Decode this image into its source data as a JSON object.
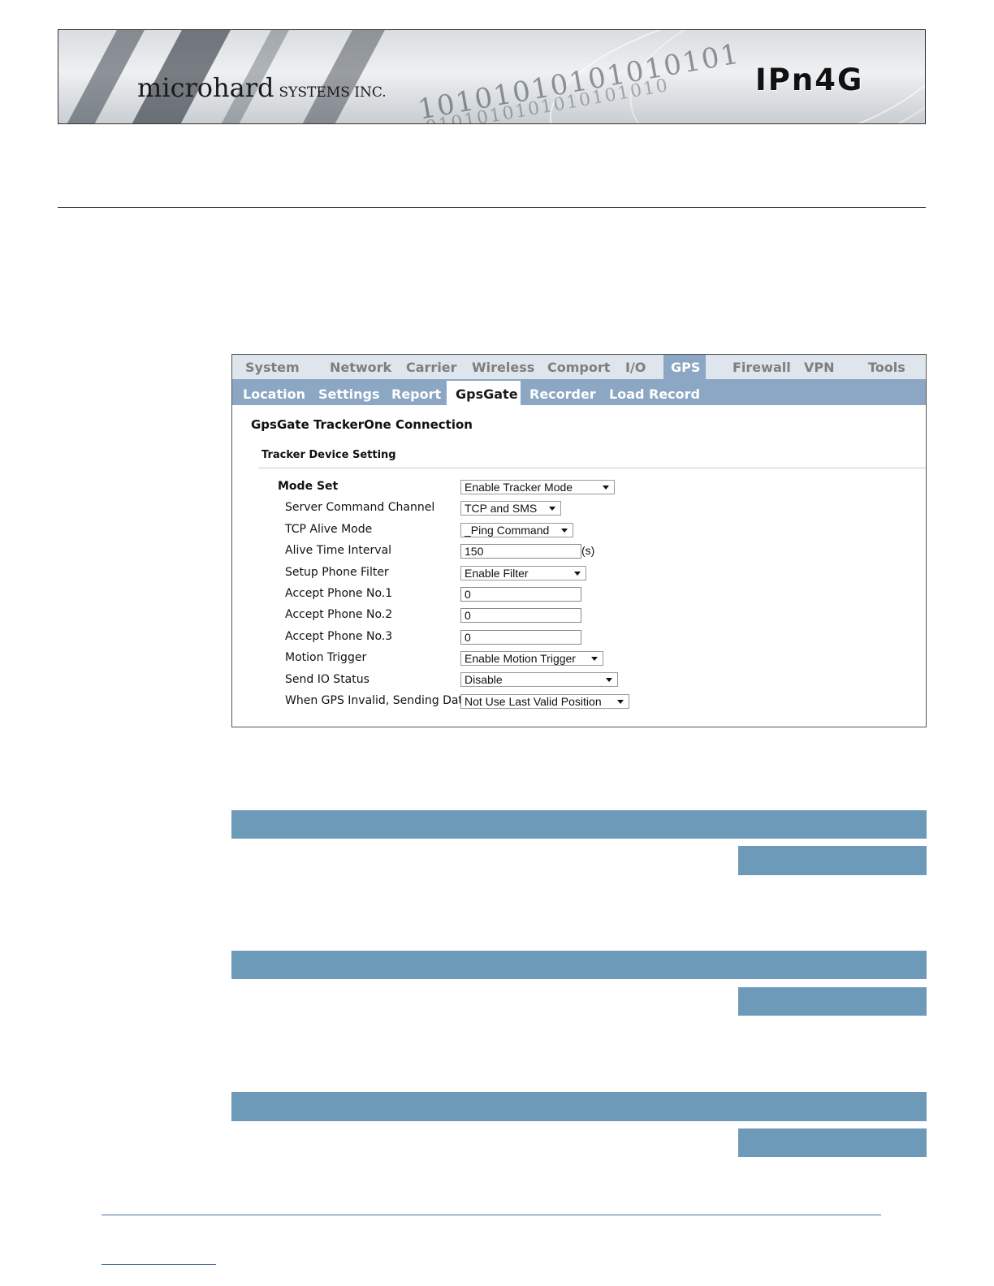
{
  "banner": {
    "brand": "microhard",
    "brand_suffix": "SYSTEMS INC.",
    "product": "IPn4G",
    "binary_1": "10101010101010101",
    "binary_2": "0101010101010101010"
  },
  "nav": {
    "main_tabs": [
      "System",
      "Network",
      "Carrier",
      "Wireless",
      "Comport",
      "I/O",
      "GPS",
      "Firewall",
      "VPN",
      "Tools"
    ],
    "main_active": "GPS",
    "sub_tabs": [
      "Location",
      "Settings",
      "Report",
      "GpsGate",
      "Recorder",
      "Load Record"
    ],
    "sub_active": "GpsGate"
  },
  "page": {
    "title": "GpsGate TrackerOne Connection",
    "section": "Tracker Device Setting"
  },
  "form": {
    "mode_set": {
      "label": "Mode Set",
      "value": "Enable Tracker Mode"
    },
    "server_command_channel": {
      "label": "Server Command Channel",
      "value": "TCP and SMS"
    },
    "tcp_alive_mode": {
      "label": "TCP Alive Mode",
      "value": "_Ping Command"
    },
    "alive_time_interval": {
      "label": "Alive Time Interval",
      "value": "150",
      "unit": "(s)"
    },
    "setup_phone_filter": {
      "label": "Setup Phone Filter",
      "value": "Enable Filter"
    },
    "accept_phone_1": {
      "label": "Accept Phone No.1",
      "value": "0"
    },
    "accept_phone_2": {
      "label": "Accept Phone No.2",
      "value": "0"
    },
    "accept_phone_3": {
      "label": "Accept Phone No.3",
      "value": "0"
    },
    "motion_trigger": {
      "label": "Motion Trigger",
      "value": "Enable Motion Trigger"
    },
    "send_io_status": {
      "label": "Send IO Status",
      "value": "Disable"
    },
    "gps_invalid": {
      "label": "When GPS Invalid, Sending Data",
      "value": "Not Use Last Valid Position"
    }
  },
  "colors": {
    "nav_active": "#8ba7c4",
    "bar_blue": "#6e9ab9"
  }
}
